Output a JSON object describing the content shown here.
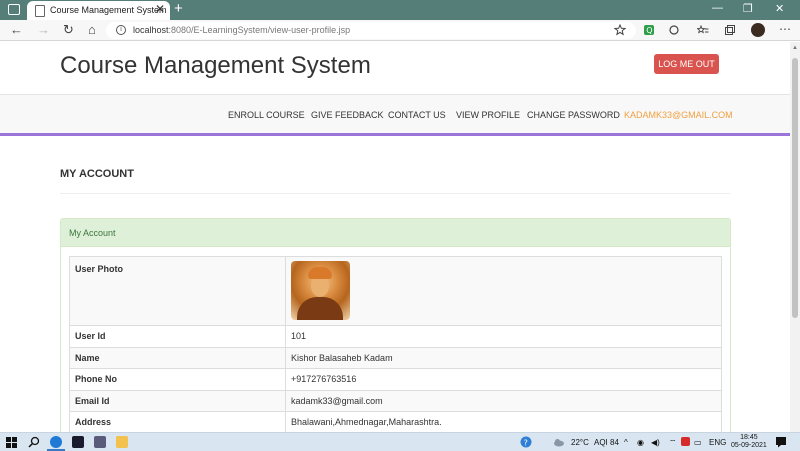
{
  "browser": {
    "tab_title": "Course Management System",
    "tab_close": "✕",
    "new_tab": "+",
    "window_controls": {
      "minimize": "—",
      "restore": "❐",
      "close": "✕"
    },
    "nav": {
      "back": "←",
      "forward": "→",
      "refresh": "↻",
      "home": "⌂"
    },
    "url_host": "localhost",
    "url_path": ":8080/E-LearningSystem/view-user-profile.jsp",
    "more": "⋯",
    "colors": {
      "tabbar": "#547e77"
    }
  },
  "header": {
    "site_title": "Course Management System",
    "logout_label": "LOG ME OUT"
  },
  "navbar": {
    "items": [
      {
        "label": "ENROLL COURSE"
      },
      {
        "label": "GIVE FEEDBACK"
      },
      {
        "label": "CONTACT US"
      },
      {
        "label": "VIEW PROFILE"
      },
      {
        "label": "CHANGE PASSWORD"
      },
      {
        "label": "KADAMK33@GMAIL.COM"
      }
    ],
    "accent_color": "#9a74d8",
    "email_color": "#f0a040"
  },
  "main": {
    "section_title": "MY ACCOUNT",
    "panel_title": "My Account",
    "rows": [
      {
        "label": "User Photo",
        "value": ""
      },
      {
        "label": "User Id",
        "value": "101"
      },
      {
        "label": "Name",
        "value": "Kishor Balasaheb Kadam"
      },
      {
        "label": "Phone No",
        "value": "+917276763516"
      },
      {
        "label": "Email Id",
        "value": "kadamk33@gmail.com"
      },
      {
        "label": "Address",
        "value": "Bhalawani,Ahmednagar,Maharashtra."
      }
    ]
  },
  "taskbar": {
    "weather": "22°C",
    "aqi": "AQI 84",
    "language": "ENG",
    "time": "18:45",
    "date": "05-09-2021"
  }
}
